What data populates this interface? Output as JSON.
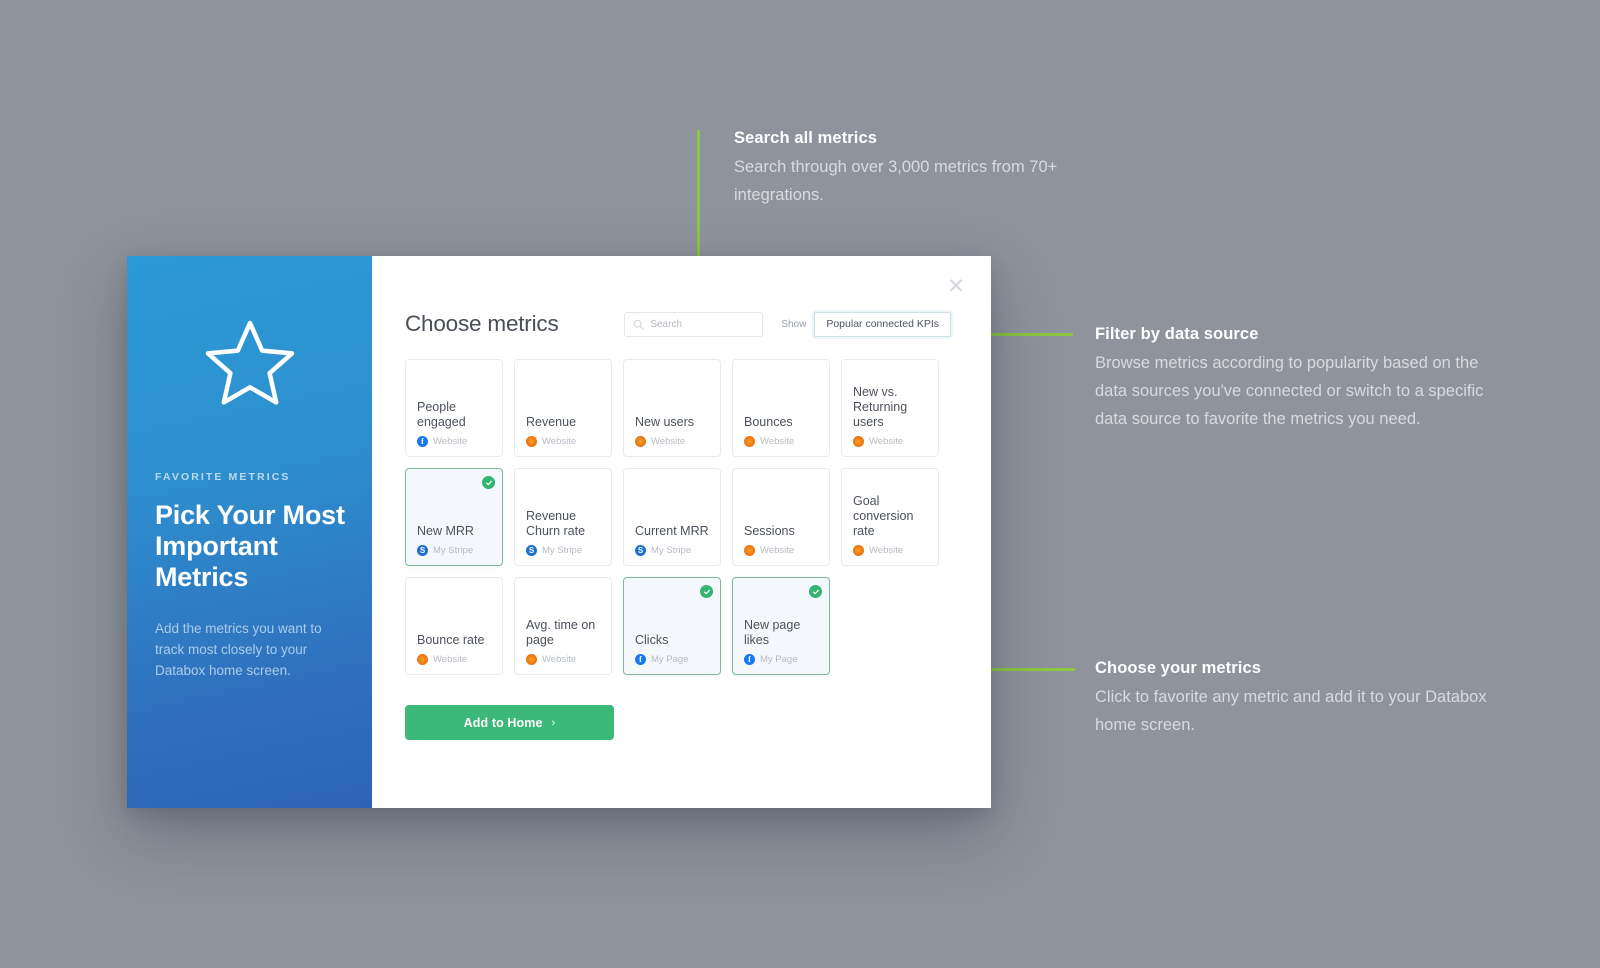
{
  "background_color": "#8f939c",
  "accent_green": "#8dc63f",
  "panel": {
    "eyebrow": "FAVORITE METRICS",
    "title": "Pick Your Most Important Metrics",
    "subtitle": "Add the metrics you want to track most closely to your Databox home screen.",
    "logo_icon": "star-icon"
  },
  "modal": {
    "title": "Choose metrics",
    "close_icon": "close-icon"
  },
  "search": {
    "placeholder": "Search",
    "value": "",
    "icon": "search-icon"
  },
  "filter": {
    "label": "Show",
    "selected": "Popular connected KPIs"
  },
  "metrics": [
    {
      "title": "People engaged",
      "source": "Website",
      "source_icon": "facebook-icon",
      "source_type": "fb",
      "selected": false
    },
    {
      "title": "Revenue",
      "source": "Website",
      "source_icon": "google-analytics-icon",
      "source_type": "ga",
      "selected": false
    },
    {
      "title": "New users",
      "source": "Website",
      "source_icon": "google-analytics-icon",
      "source_type": "ga",
      "selected": false
    },
    {
      "title": "Bounces",
      "source": "Website",
      "source_icon": "google-analytics-icon",
      "source_type": "ga",
      "selected": false
    },
    {
      "title": "New vs. Returning users",
      "source": "Website",
      "source_icon": "google-analytics-icon",
      "source_type": "ga",
      "selected": false
    },
    {
      "title": "New MRR",
      "source": "My Stripe",
      "source_icon": "stripe-icon",
      "source_type": "stripe",
      "selected": true
    },
    {
      "title": "Revenue Churn rate",
      "source": "My Stripe",
      "source_icon": "stripe-icon",
      "source_type": "stripe",
      "selected": false
    },
    {
      "title": "Current MRR",
      "source": "My Stripe",
      "source_icon": "stripe-icon",
      "source_type": "stripe",
      "selected": false
    },
    {
      "title": "Sessions",
      "source": "Website",
      "source_icon": "google-analytics-icon",
      "source_type": "ga",
      "selected": false
    },
    {
      "title": "Goal conversion rate",
      "source": "Website",
      "source_icon": "google-analytics-icon",
      "source_type": "ga",
      "selected": false
    },
    {
      "title": "Bounce rate",
      "source": "Website",
      "source_icon": "google-analytics-icon",
      "source_type": "ga",
      "selected": false
    },
    {
      "title": "Avg. time on page",
      "source": "Website",
      "source_icon": "google-analytics-icon",
      "source_type": "ga",
      "selected": false
    },
    {
      "title": "Clicks",
      "source": "My Page",
      "source_icon": "facebook-icon",
      "source_type": "fb",
      "selected": true
    },
    {
      "title": "New page likes",
      "source": "My Page",
      "source_icon": "facebook-icon",
      "source_type": "fb",
      "selected": true
    }
  ],
  "footer": {
    "add_to_home_label": "Add to Home",
    "chevron": "›"
  },
  "callouts": [
    {
      "heading": "Search all metrics",
      "body": "Search through over 3,000 metrics from 70+ integrations."
    },
    {
      "heading": "Filter by data source",
      "body": "Browse metrics according to popularity based on the data sources you've connected or switch to a specific data source to favorite the metrics you need."
    },
    {
      "heading": "Choose your metrics",
      "body": "Click to favorite any metric and add it to your Databox home screen."
    }
  ]
}
